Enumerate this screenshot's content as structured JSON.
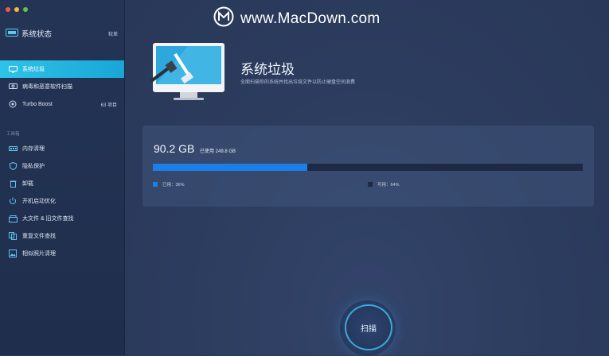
{
  "sidebar": {
    "title": "系统状态",
    "header_count": "较差",
    "items": [
      {
        "label": "系统垃圾",
        "badge": "",
        "active": true
      },
      {
        "label": "病毒和恶意软件扫描",
        "badge": ""
      },
      {
        "label": "Turbo Boost",
        "badge": "63 项目"
      }
    ],
    "tools_label": "工具箱",
    "tools": [
      {
        "label": "内存清理"
      },
      {
        "label": "隐私保护"
      },
      {
        "label": "卸载"
      },
      {
        "label": "开机启动优化"
      },
      {
        "label": "大文件 & 旧文件查找"
      },
      {
        "label": "重复文件查找"
      },
      {
        "label": "相似照片清理"
      }
    ]
  },
  "watermark": "www.MacDown.com",
  "hero": {
    "title": "系统垃圾",
    "subtitle": "全面扫描你的系统并找出垃圾文件以防止硬盘空间浪费"
  },
  "disk": {
    "size": "90.2 GB",
    "used_text": "已使用 249.8 GB",
    "used_fraction": 0.36,
    "legend_used": "已用：36%",
    "legend_free": "可用：64%",
    "used_color": "#1a7fe6",
    "free_color": "#1e2a44"
  },
  "scan_button": "扫描",
  "colors": {
    "accent": "#2dc3e8",
    "background": "#2b3a59",
    "sidebar": "#243455"
  }
}
